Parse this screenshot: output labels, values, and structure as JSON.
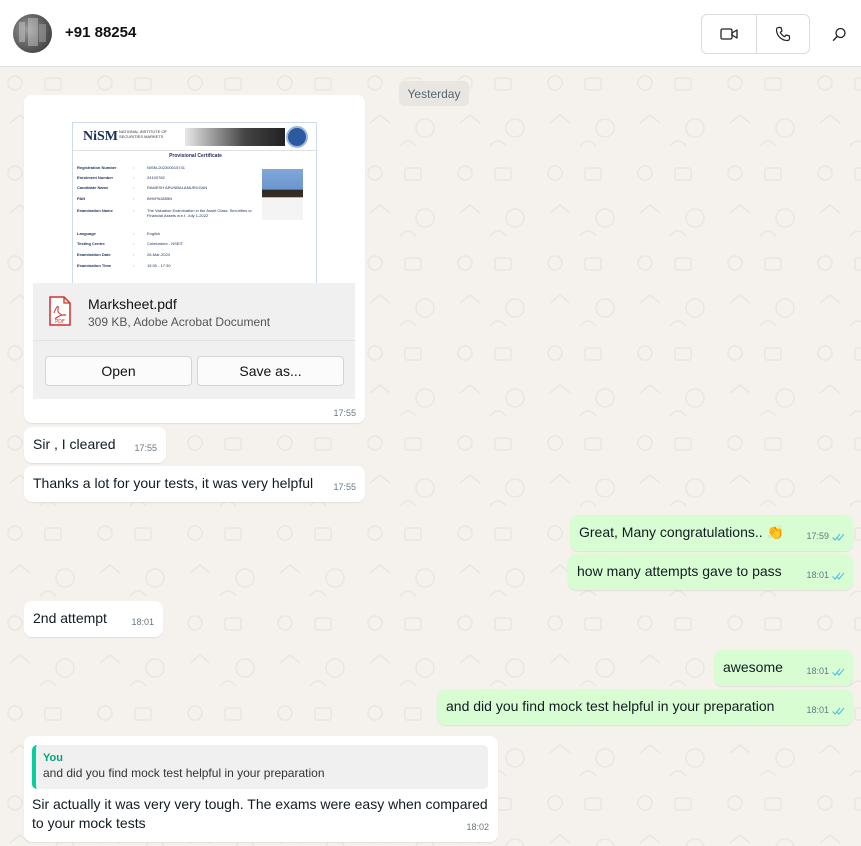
{
  "header": {
    "contact_name": "+91 88254",
    "video_call_icon": "video-camera-icon",
    "voice_call_icon": "phone-icon",
    "search_icon": "search-icon"
  },
  "chat": {
    "date_separator": "Yesterday",
    "document": {
      "file_name": "Marksheet.pdf",
      "file_meta": "309 KB, Adobe Acrobat Document",
      "open_label": "Open",
      "save_label": "Save as...",
      "time": "17:55",
      "preview": {
        "logo": "NiSM",
        "org": "NATIONAL INSTITUTE OF SECURITIES MARKETS",
        "title": "Provisional Certificate",
        "rows": [
          {
            "k": "Registration Number",
            "v": "NISM-202300015741"
          },
          {
            "k": "Enrolment Number",
            "v": "24100782"
          },
          {
            "k": "Candidate Name",
            "v": "RAMESH ARUNBALAMURUGAN"
          },
          {
            "k": "PAN",
            "v": "BHKPA3855N"
          },
          {
            "k": "Examination Name",
            "v": "The Valuation Examination in the Asset Class: Securities or Financial Assets w.e.f. July 1-2022"
          },
          {
            "k": "Language",
            "v": "English"
          },
          {
            "k": "Testing Centre",
            "v": "Coimbatore - NSEIT"
          },
          {
            "k": "Examination Date",
            "v": "26-Mar-2024"
          },
          {
            "k": "Examination Time",
            "v": "15:30 - 17:30"
          }
        ]
      }
    },
    "messages": [
      {
        "dir": "in",
        "text": "Sir , I cleared",
        "time": "17:55"
      },
      {
        "dir": "in",
        "text": "Thanks a lot for your tests, it was very helpful",
        "time": "17:55"
      },
      {
        "dir": "out",
        "text": "Great, Many congratulations.. 👏",
        "time": "17:59"
      },
      {
        "dir": "out",
        "text": "how many attempts gave to pass",
        "time": "18:01"
      },
      {
        "dir": "in",
        "text": "2nd attempt",
        "time": "18:01"
      },
      {
        "dir": "out",
        "text": "awesome",
        "time": "18:01"
      },
      {
        "dir": "out",
        "text": "and did you find mock test helpful in your preparation",
        "time": "18:01"
      },
      {
        "dir": "in",
        "text": "Sir actually it was very very tough. The exams were easy when compared to your mock tests",
        "time": "18:02",
        "quote": {
          "author": "You",
          "text": "and did you find mock test helpful in your preparation"
        }
      }
    ]
  },
  "colors": {
    "incoming_bubble": "#ffffff",
    "outgoing_bubble": "#d9fdd3",
    "read_ticks": "#53bdeb",
    "quote_accent": "#06cf9c",
    "background": "#f5f2ee"
  }
}
